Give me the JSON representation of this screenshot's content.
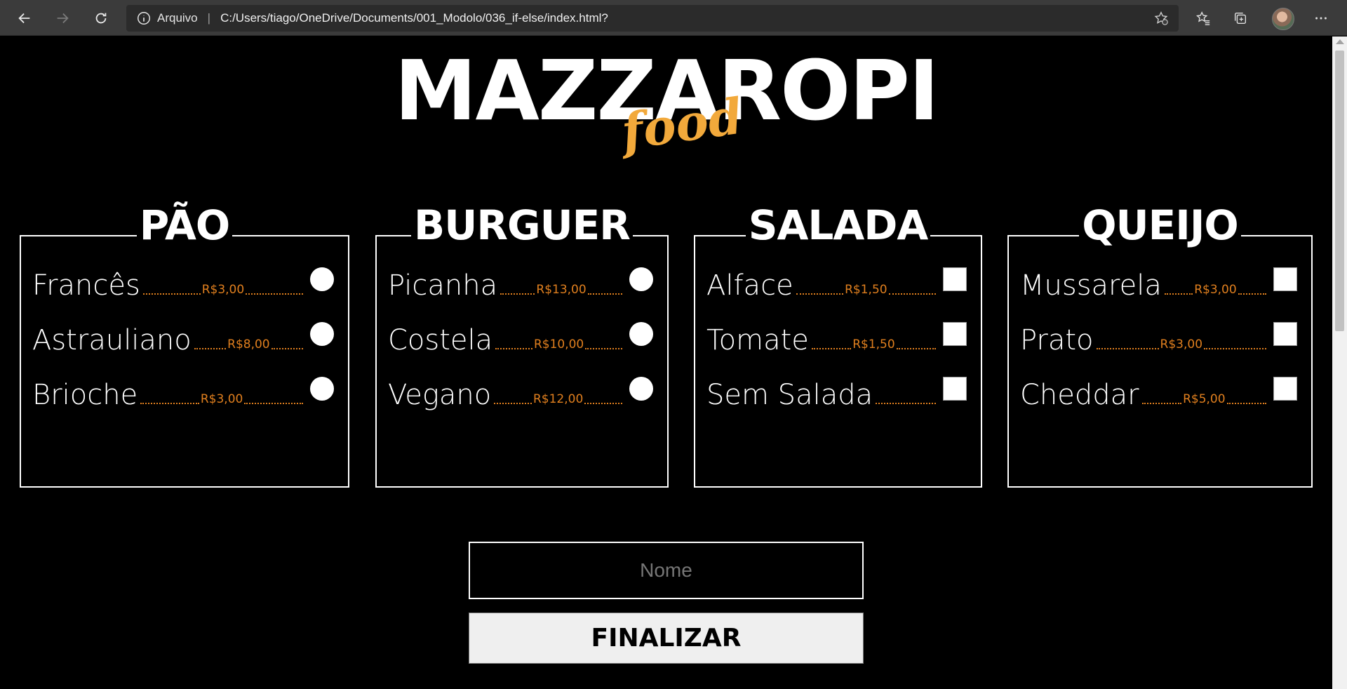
{
  "browser": {
    "site_info_label": "Arquivo",
    "separator": "|",
    "url": "C:/Users/tiago/OneDrive/Documents/001_Modolo/036_if-else/index.html?"
  },
  "logo": {
    "main": "MAZZAROPI",
    "sub": "food",
    "sub_color": "#f2a93b"
  },
  "accent_price_color": "#e07f1e",
  "sections": {
    "pao": {
      "title": "PÃO",
      "input_type": "radio",
      "items": [
        {
          "name": "Francês",
          "price": "R$3,00"
        },
        {
          "name": "Astrauliano",
          "price": "R$8,00"
        },
        {
          "name": "Brioche",
          "price": "R$3,00"
        }
      ]
    },
    "burguer": {
      "title": "BURGUER",
      "input_type": "radio",
      "items": [
        {
          "name": "Picanha",
          "price": "R$13,00"
        },
        {
          "name": "Costela",
          "price": "R$10,00"
        },
        {
          "name": "Vegano",
          "price": "R$12,00"
        }
      ]
    },
    "salada": {
      "title": "SALADA",
      "input_type": "checkbox",
      "items": [
        {
          "name": "Alface",
          "price": "R$1,50"
        },
        {
          "name": "Tomate",
          "price": "R$1,50"
        },
        {
          "name": "Sem Salada",
          "price": ""
        }
      ]
    },
    "queijo": {
      "title": "QUEIJO",
      "input_type": "checkbox",
      "items": [
        {
          "name": "Mussarela",
          "price": "R$3,00"
        },
        {
          "name": "Prato",
          "price": "R$3,00"
        },
        {
          "name": "Cheddar",
          "price": "R$5,00"
        }
      ]
    }
  },
  "form": {
    "name_placeholder": "Nome",
    "name_value": "",
    "submit_label": "FINALIZAR"
  }
}
